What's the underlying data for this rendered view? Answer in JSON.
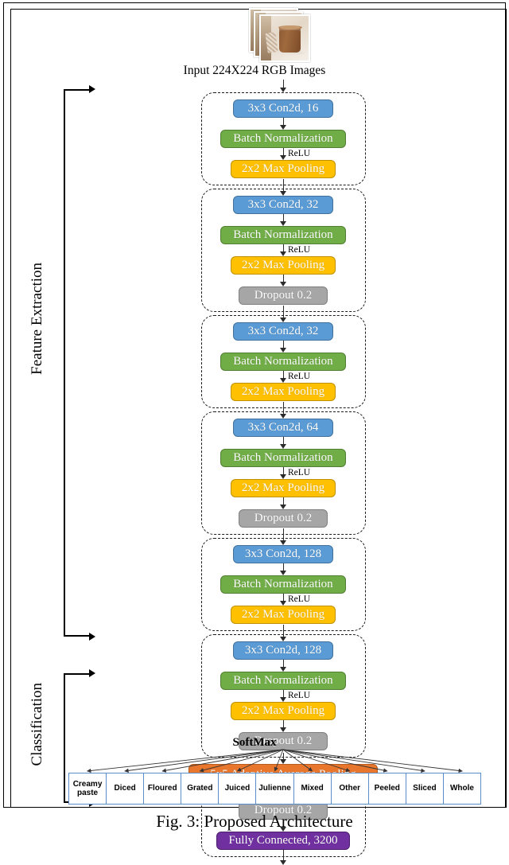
{
  "caption": "Fig. 3: Proposed Architecture",
  "input": {
    "label": "Input 224X224 RGB Images",
    "image_alt": "stacked-food-photos"
  },
  "sections": [
    {
      "id": "feature-extraction",
      "label": "Feature Extraction"
    },
    {
      "id": "classification",
      "label": "Classification"
    }
  ],
  "relu_label": "ReLU",
  "blocks": [
    {
      "id": "conv-block-1",
      "layers": [
        {
          "name": "conv",
          "label": "3x3 Con2d, 16",
          "color": "#5B9BD5"
        },
        {
          "name": "batchnorm",
          "label": "Batch Normalization",
          "color": "#70AD47"
        },
        {
          "name": "maxpool",
          "label": "2x2 Max Pooling",
          "color": "#FFC000"
        }
      ]
    },
    {
      "id": "conv-block-2",
      "layers": [
        {
          "name": "conv",
          "label": "3x3 Con2d, 32",
          "color": "#5B9BD5"
        },
        {
          "name": "batchnorm",
          "label": "Batch Normalization",
          "color": "#70AD47"
        },
        {
          "name": "maxpool",
          "label": "2x2 Max Pooling",
          "color": "#FFC000"
        },
        {
          "name": "dropout",
          "label": "Dropout 0.2",
          "color": "#A6A6A6"
        }
      ]
    },
    {
      "id": "conv-block-3",
      "layers": [
        {
          "name": "conv",
          "label": "3x3 Con2d, 32",
          "color": "#5B9BD5"
        },
        {
          "name": "batchnorm",
          "label": "Batch Normalization",
          "color": "#70AD47"
        },
        {
          "name": "maxpool",
          "label": "2x2 Max Pooling",
          "color": "#FFC000"
        }
      ]
    },
    {
      "id": "conv-block-4",
      "layers": [
        {
          "name": "conv",
          "label": "3x3 Con2d, 64",
          "color": "#5B9BD5"
        },
        {
          "name": "batchnorm",
          "label": "Batch Normalization",
          "color": "#70AD47"
        },
        {
          "name": "maxpool",
          "label": "2x2 Max Pooling",
          "color": "#FFC000"
        },
        {
          "name": "dropout",
          "label": "Dropout 0.2",
          "color": "#A6A6A6"
        }
      ]
    },
    {
      "id": "conv-block-5",
      "layers": [
        {
          "name": "conv",
          "label": "3x3 Con2d, 128",
          "color": "#5B9BD5"
        },
        {
          "name": "batchnorm",
          "label": "Batch Normalization",
          "color": "#70AD47"
        },
        {
          "name": "maxpool",
          "label": "2x2 Max Pooling",
          "color": "#FFC000"
        }
      ]
    },
    {
      "id": "conv-block-6",
      "layers": [
        {
          "name": "conv",
          "label": "3x3 Con2d, 128",
          "color": "#5B9BD5"
        },
        {
          "name": "batchnorm",
          "label": "Batch Normalization",
          "color": "#70AD47"
        },
        {
          "name": "maxpool",
          "label": "2x2 Max Pooling",
          "color": "#FFC000"
        },
        {
          "name": "dropout",
          "label": "Dropout 0.2",
          "color": "#A6A6A6"
        }
      ]
    }
  ],
  "adaptive_pool": {
    "label": "5x5 Adaptive Average Pooling",
    "color": "#E8762C"
  },
  "classifier_block": {
    "layers": [
      {
        "name": "dropout",
        "label": "Dropout 0.2",
        "color": "#A6A6A6"
      },
      {
        "name": "fully-connected",
        "label": "Fully Connected, 3200",
        "color": "#7030A0"
      }
    ]
  },
  "softmax": {
    "label": "SoftMax"
  },
  "classes": [
    "Creamy paste",
    "Diced",
    "Floured",
    "Grated",
    "Juiced",
    "Julienne",
    "Mixed",
    "Other",
    "Peeled",
    "Sliced",
    "Whole"
  ]
}
